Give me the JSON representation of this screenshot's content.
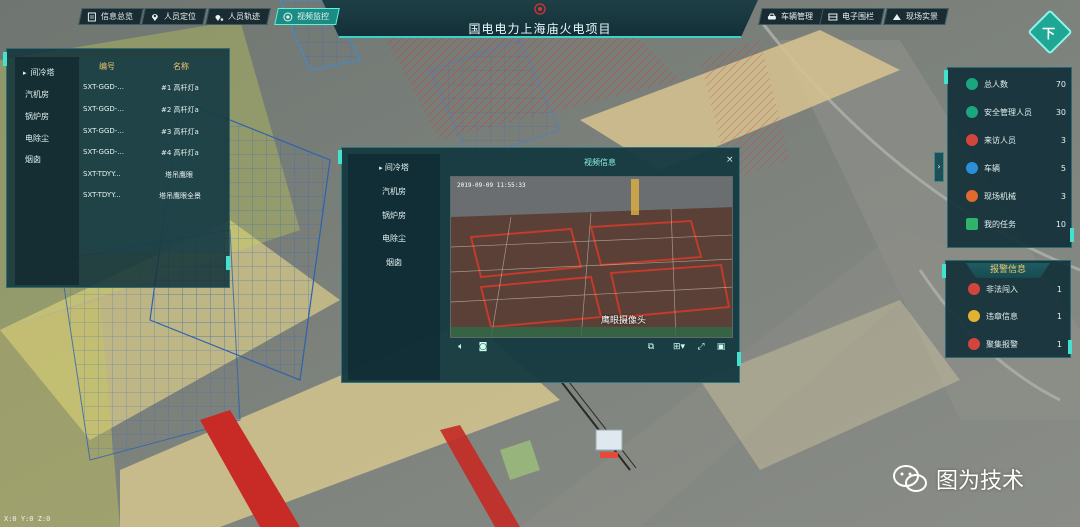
{
  "header": {
    "title": "国电电力上海庙火电项目",
    "nav_left": [
      {
        "label": "信息总览",
        "icon": "document-icon",
        "active": false
      },
      {
        "label": "人员定位",
        "icon": "location-pin-icon",
        "active": false
      },
      {
        "label": "人员轨迹",
        "icon": "route-pin-icon",
        "active": false
      },
      {
        "label": "视频监控",
        "icon": "camera-icon",
        "active": true
      }
    ],
    "nav_right": [
      {
        "label": "车辆管理",
        "icon": "car-icon"
      },
      {
        "label": "电子围栏",
        "icon": "fence-icon"
      },
      {
        "label": "现场实景",
        "icon": "scene-icon"
      }
    ],
    "corner_label": "下"
  },
  "left_panel": {
    "categories": [
      {
        "label": "间冷塔",
        "active": true
      },
      {
        "label": "汽机房",
        "active": false
      },
      {
        "label": "锅炉房",
        "active": false
      },
      {
        "label": "电除尘",
        "active": false
      },
      {
        "label": "烟囱",
        "active": false
      }
    ],
    "table": {
      "headers": [
        "编号",
        "名称"
      ],
      "rows": [
        [
          "SXT-GGD-...",
          "#1 高杆灯a"
        ],
        [
          "SXT-GGD-...",
          "#2 高杆灯a"
        ],
        [
          "SXT-GGD-...",
          "#3 高杆灯a"
        ],
        [
          "SXT-GGD-...",
          "#4 高杆灯a"
        ],
        [
          "SXT-TDYY...",
          "塔吊鹰眼"
        ],
        [
          "SXT-TDYY...",
          "塔吊鹰眼全景"
        ]
      ]
    }
  },
  "stats": [
    {
      "label": "总人数",
      "value": "70",
      "color": "#1aa67e",
      "icon": "people-icon"
    },
    {
      "label": "安全管理人员",
      "value": "30",
      "color": "#1aa67e",
      "icon": "safety-officer-icon"
    },
    {
      "label": "来访人员",
      "value": "3",
      "color": "#d2453d",
      "icon": "visitor-icon"
    },
    {
      "label": "车辆",
      "value": "5",
      "color": "#2a8fd6",
      "icon": "vehicle-icon"
    },
    {
      "label": "现场机械",
      "value": "3",
      "color": "#e06b2c",
      "icon": "machinery-icon"
    },
    {
      "label": "我的任务",
      "value": "10",
      "color": "#2fb36b",
      "icon": "task-icon"
    }
  ],
  "alarm": {
    "title": "报警信息",
    "rows": [
      {
        "label": "非法闯入",
        "value": "1",
        "color": "#d2453d",
        "icon": "intrusion-icon"
      },
      {
        "label": "违章信息",
        "value": "1",
        "color": "#e2b230",
        "icon": "violation-icon"
      },
      {
        "label": "聚集报警",
        "value": "1",
        "color": "#d2453d",
        "icon": "crowd-alarm-icon"
      }
    ]
  },
  "video": {
    "title": "视频信息",
    "close": "×",
    "categories": [
      {
        "label": "间冷塔",
        "active": true
      },
      {
        "label": "汽机房",
        "active": false
      },
      {
        "label": "锅炉房",
        "active": false
      },
      {
        "label": "电除尘",
        "active": false
      },
      {
        "label": "烟囱",
        "active": false
      }
    ],
    "overlay_text": "鹰眼摄像头",
    "controls_left": [
      "volume-icon",
      "snapshot-icon"
    ],
    "controls_right": [
      "record-icon",
      "layout-icon",
      "fullscreen-icon",
      "screen-icon"
    ]
  },
  "coords": "X:0  Y:0  Z:0",
  "watermark": "图为技术"
}
